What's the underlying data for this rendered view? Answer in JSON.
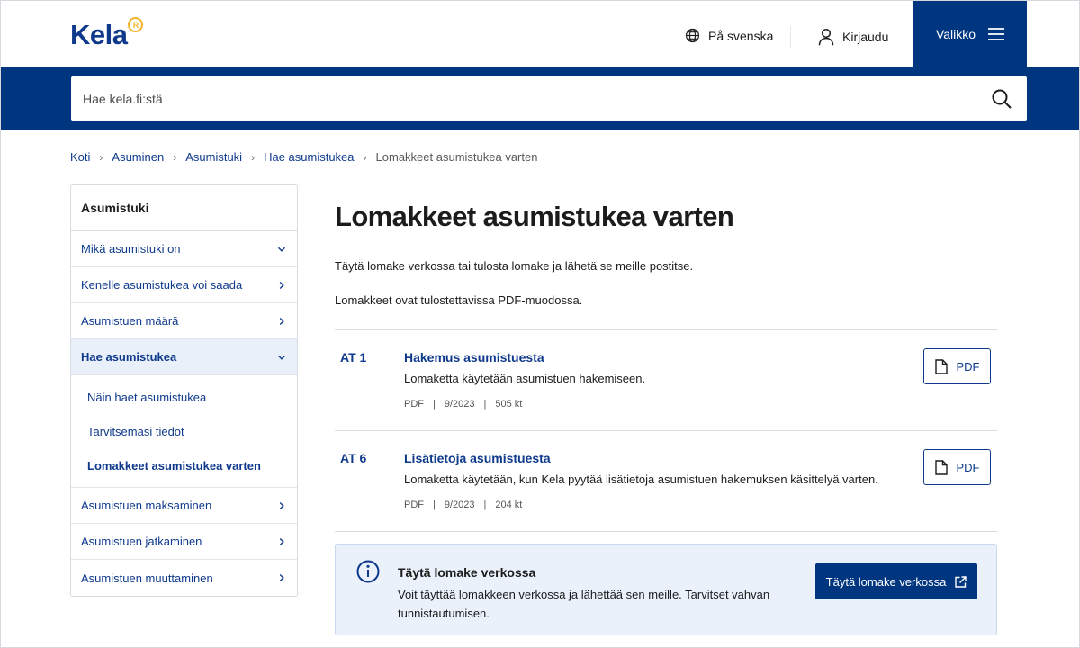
{
  "header": {
    "logo_text": "Kela",
    "logo_badge": "R",
    "language_label": "På svenska",
    "login_label": "Kirjaudu",
    "menu_label": "Valikko"
  },
  "search": {
    "placeholder": "Hae kela.fi:stä"
  },
  "breadcrumb": {
    "items": [
      "Koti",
      "Asuminen",
      "Asumistuki",
      "Hae asumistukea"
    ],
    "current": "Lomakkeet asumistukea varten"
  },
  "sidebar": {
    "title": "Asumistuki",
    "items": [
      {
        "label": "Mikä asumistuki on",
        "chevron": "down"
      },
      {
        "label": "Kenelle asumistukea voi saada",
        "chevron": "right"
      },
      {
        "label": "Asumistuen määrä",
        "chevron": "right"
      },
      {
        "label": "Hae asumistukea",
        "chevron": "down",
        "active": true
      },
      {
        "label": "Asumistuen maksaminen",
        "chevron": "right"
      },
      {
        "label": "Asumistuen jatkaminen",
        "chevron": "right"
      },
      {
        "label": "Asumistuen muuttaminen",
        "chevron": "right"
      }
    ],
    "subitems": [
      {
        "label": "Näin haet asumistukea"
      },
      {
        "label": "Tarvitsemasi tiedot"
      },
      {
        "label": "Lomakkeet asumistukea varten",
        "current": true
      }
    ]
  },
  "main": {
    "title": "Lomakkeet asumistukea varten",
    "intro1": "Täytä lomake verkossa tai tulosta lomake ja lähetä se meille postitse.",
    "intro2": "Lomakkeet ovat tulostettavissa PDF-muodossa.",
    "forms": [
      {
        "code": "AT 1",
        "title": "Hakemus asumistuesta",
        "description": "Lomaketta käytetään asumistuen hakemiseen.",
        "format": "PDF",
        "date": "9/2023",
        "size": "505 kt",
        "button_label": "PDF"
      },
      {
        "code": "AT 6",
        "title": "Lisätietoja asumistuesta",
        "description": "Lomaketta käytetään, kun Kela pyytää lisätietoja asumistuen hakemuksen käsittelyä varten.",
        "format": "PDF",
        "date": "9/2023",
        "size": "204 kt",
        "button_label": "PDF"
      }
    ],
    "meta_separator": "|"
  },
  "info_box": {
    "title": "Täytä lomake verkossa",
    "text": "Voit täyttää lomakkeen verkossa ja lähettää sen meille. Tarvitset vahvan tunnistautumisen.",
    "button_label": "Täytä lomake verkossa"
  },
  "colors": {
    "brand_blue": "#003580",
    "link_blue": "#0f3a8c",
    "logo_accent": "#f3b52a",
    "info_bg": "#eaf1fb"
  }
}
